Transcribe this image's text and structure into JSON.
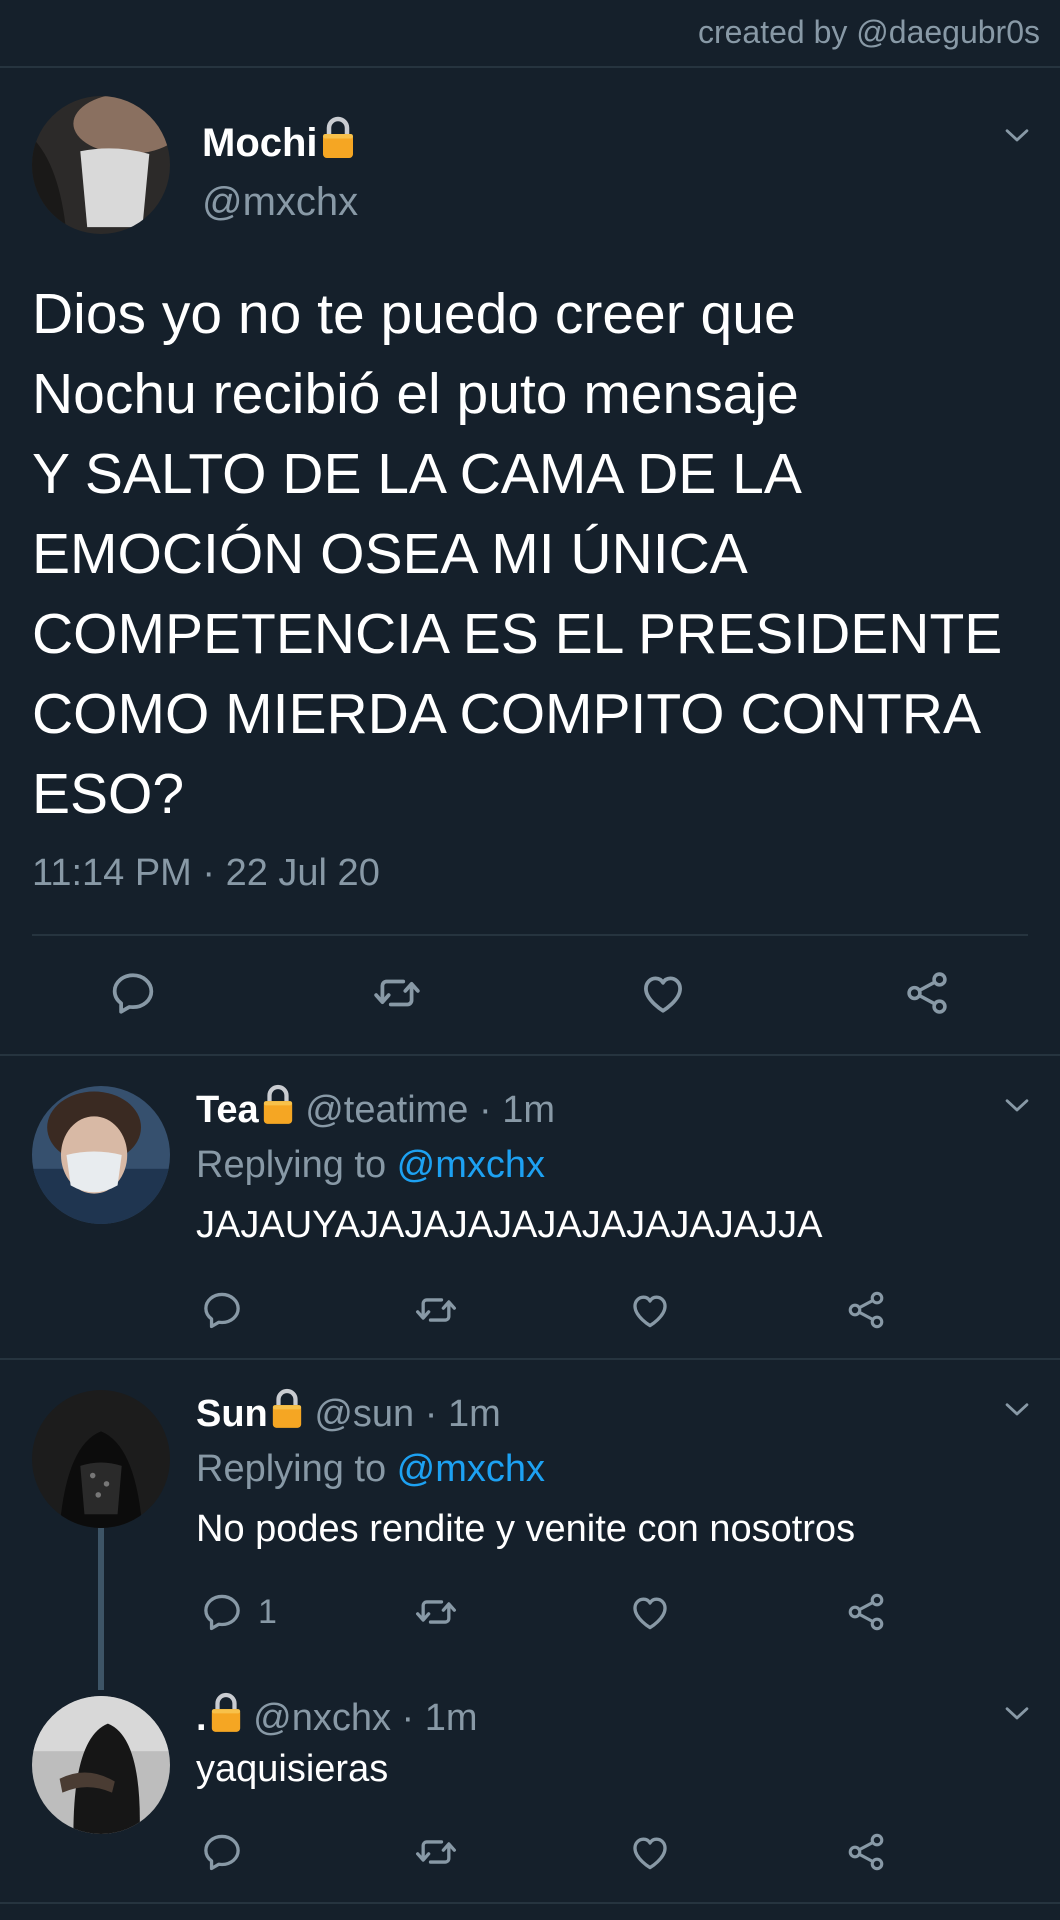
{
  "credit": "created by @daegubr0s",
  "colors": {
    "background": "#15202b",
    "secondary_text": "#8899a6",
    "link": "#1da1f2",
    "lock": "#f5a623"
  },
  "main_tweet": {
    "name": "Mochi",
    "lock_icon": "lock-icon",
    "handle": "@mxchx",
    "text": "Dios yo no te puedo creer que\nNochu recibió el puto mensaje\nY SALTO DE LA CAMA DE LA\nEMOCIÓN OSEA MI ÚNICA\nCOMPETENCIA ES EL PRESIDENTE\nCOMO MIERDA COMPITO CONTRA\nESO?",
    "timestamp": "11:14 PM · 22 Jul 20",
    "actions": [
      "reply-icon",
      "retweet-icon",
      "like-icon",
      "share-icon"
    ]
  },
  "replies": [
    {
      "name": "Tea",
      "handle": "@teatime",
      "time": "· 1m",
      "replying_prefix": "Replying to ",
      "replying_to": "@mxchx",
      "text": "JAJAUYAJAJAJAJAJAJAJAJAJAJJA",
      "reply_count": ""
    },
    {
      "name": "Sun",
      "handle": "@sun",
      "time": "· 1m",
      "replying_prefix": "Replying to ",
      "replying_to": "@mxchx",
      "text": "No podes rendite y venite con nosotros",
      "reply_count": "1"
    },
    {
      "name": ".",
      "handle": "@nxchx",
      "time": "· 1m",
      "text": "yaquisieras",
      "reply_count": ""
    }
  ]
}
